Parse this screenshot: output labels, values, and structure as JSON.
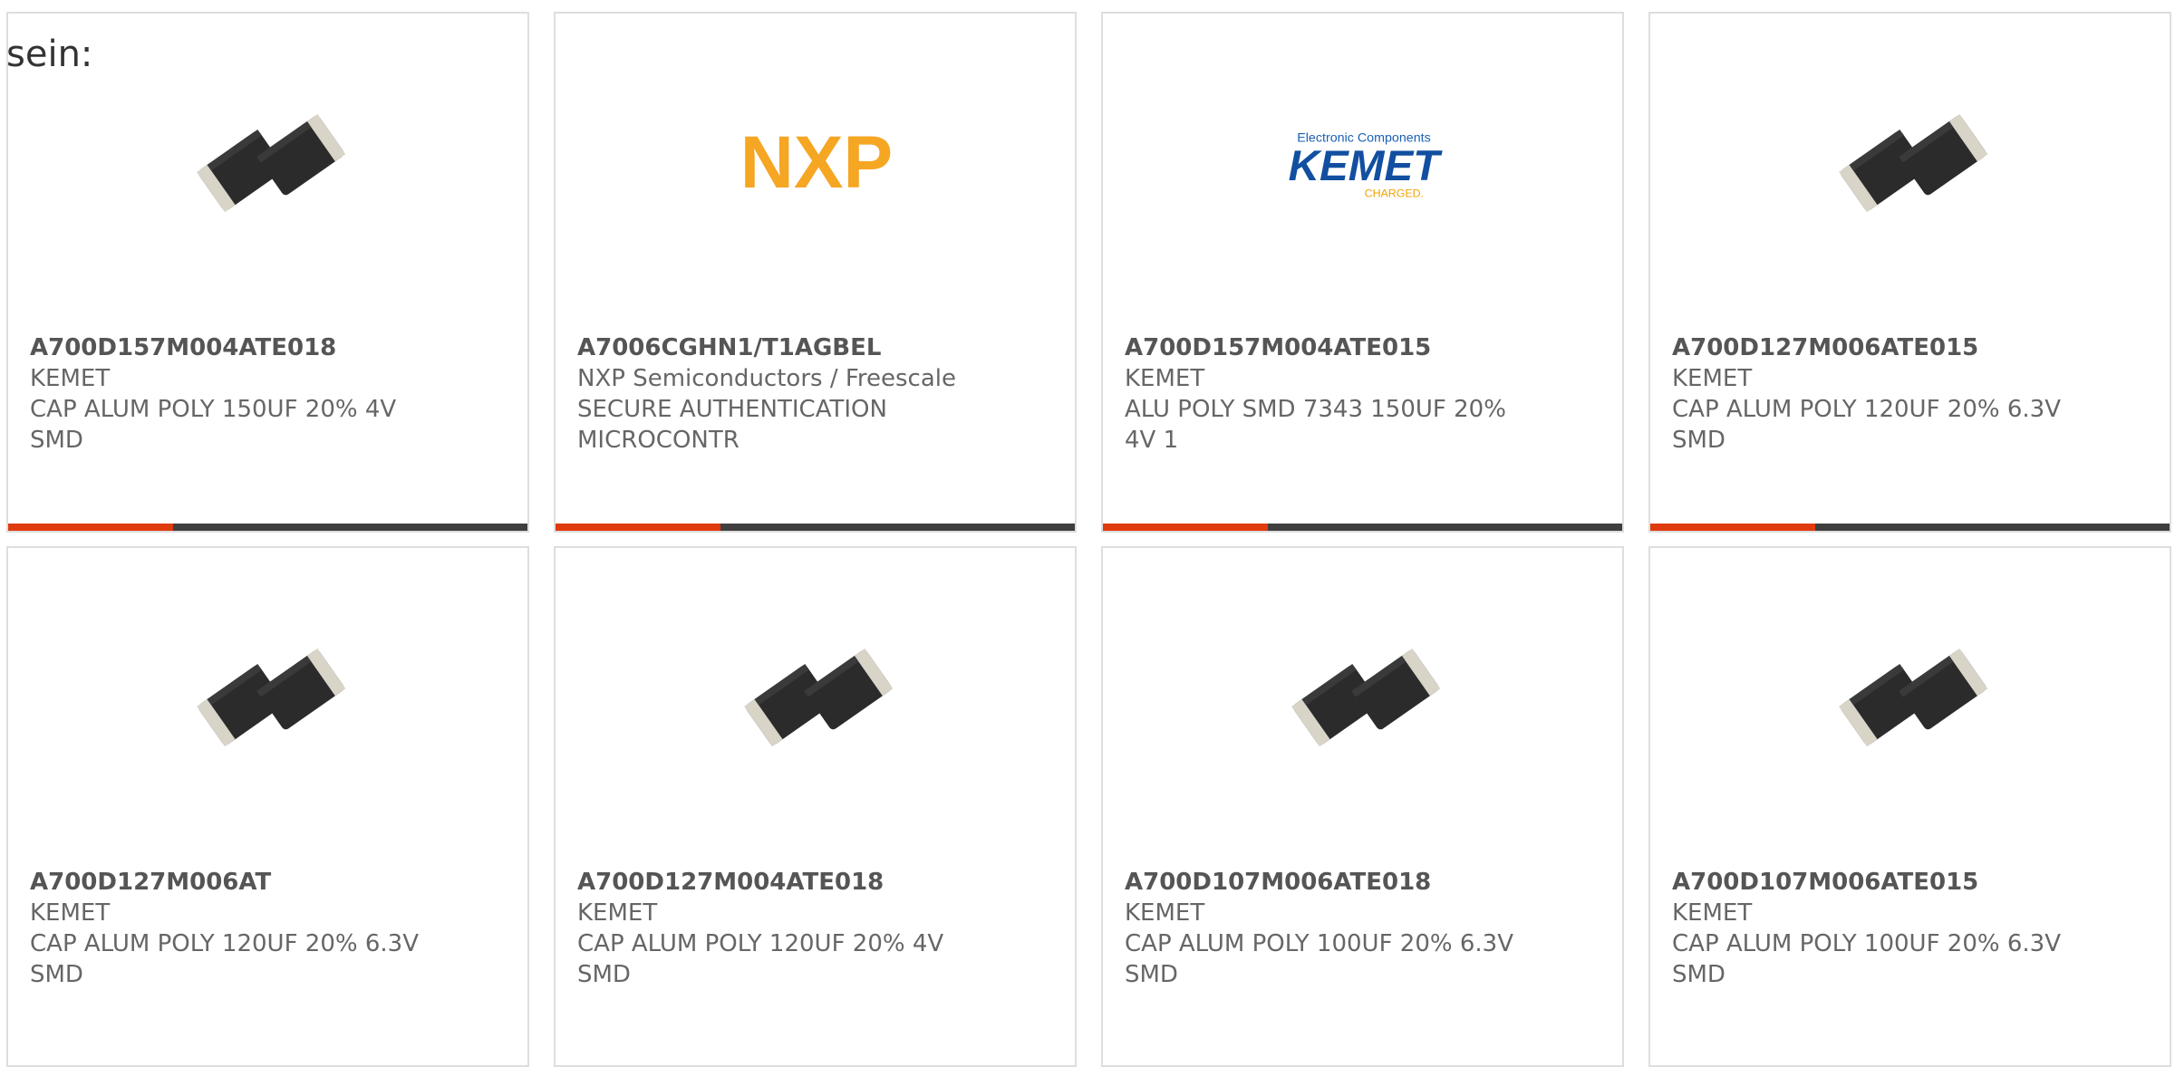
{
  "intro_text": "sein:",
  "colors": {
    "accent": "#e03b0e",
    "bar": "#3f3f3f",
    "border": "#dedede",
    "text": "#666666"
  },
  "products": [
    {
      "part_number": "A700D157M004ATE018",
      "manufacturer": "KEMET",
      "description": "CAP ALUM POLY 150UF 20% 4V SMD",
      "image": "capacitor"
    },
    {
      "part_number": "A7006CGHN1/T1AGBEL",
      "manufacturer": "NXP Semiconductors / Freescale",
      "description": "SECURE AUTHENTICATION MICROCONTR",
      "image": "nxp-logo"
    },
    {
      "part_number": "A700D157M004ATE015",
      "manufacturer": "KEMET",
      "description": "ALU POLY SMD 7343 150UF 20% 4V 1",
      "image": "kemet-logo"
    },
    {
      "part_number": "A700D127M006ATE015",
      "manufacturer": "KEMET",
      "description": "CAP ALUM POLY 120UF 20% 6.3V SMD",
      "image": "capacitor"
    },
    {
      "part_number": "A700D127M006AT",
      "manufacturer": "KEMET",
      "description": "CAP ALUM POLY 120UF 20% 6.3V SMD",
      "image": "capacitor"
    },
    {
      "part_number": "A700D127M004ATE018",
      "manufacturer": "KEMET",
      "description": "CAP ALUM POLY 120UF 20% 4V SMD",
      "image": "capacitor"
    },
    {
      "part_number": "A700D107M006ATE018",
      "manufacturer": "KEMET",
      "description": "CAP ALUM POLY 100UF 20% 6.3V SMD",
      "image": "capacitor"
    },
    {
      "part_number": "A700D107M006ATE015",
      "manufacturer": "KEMET",
      "description": "CAP ALUM POLY 100UF 20% 6.3V SMD",
      "image": "capacitor"
    }
  ],
  "logos": {
    "nxp": "NXP",
    "kemet_top": "Electronic Components",
    "kemet_main": "KEMET",
    "kemet_bottom": "CHARGED."
  }
}
